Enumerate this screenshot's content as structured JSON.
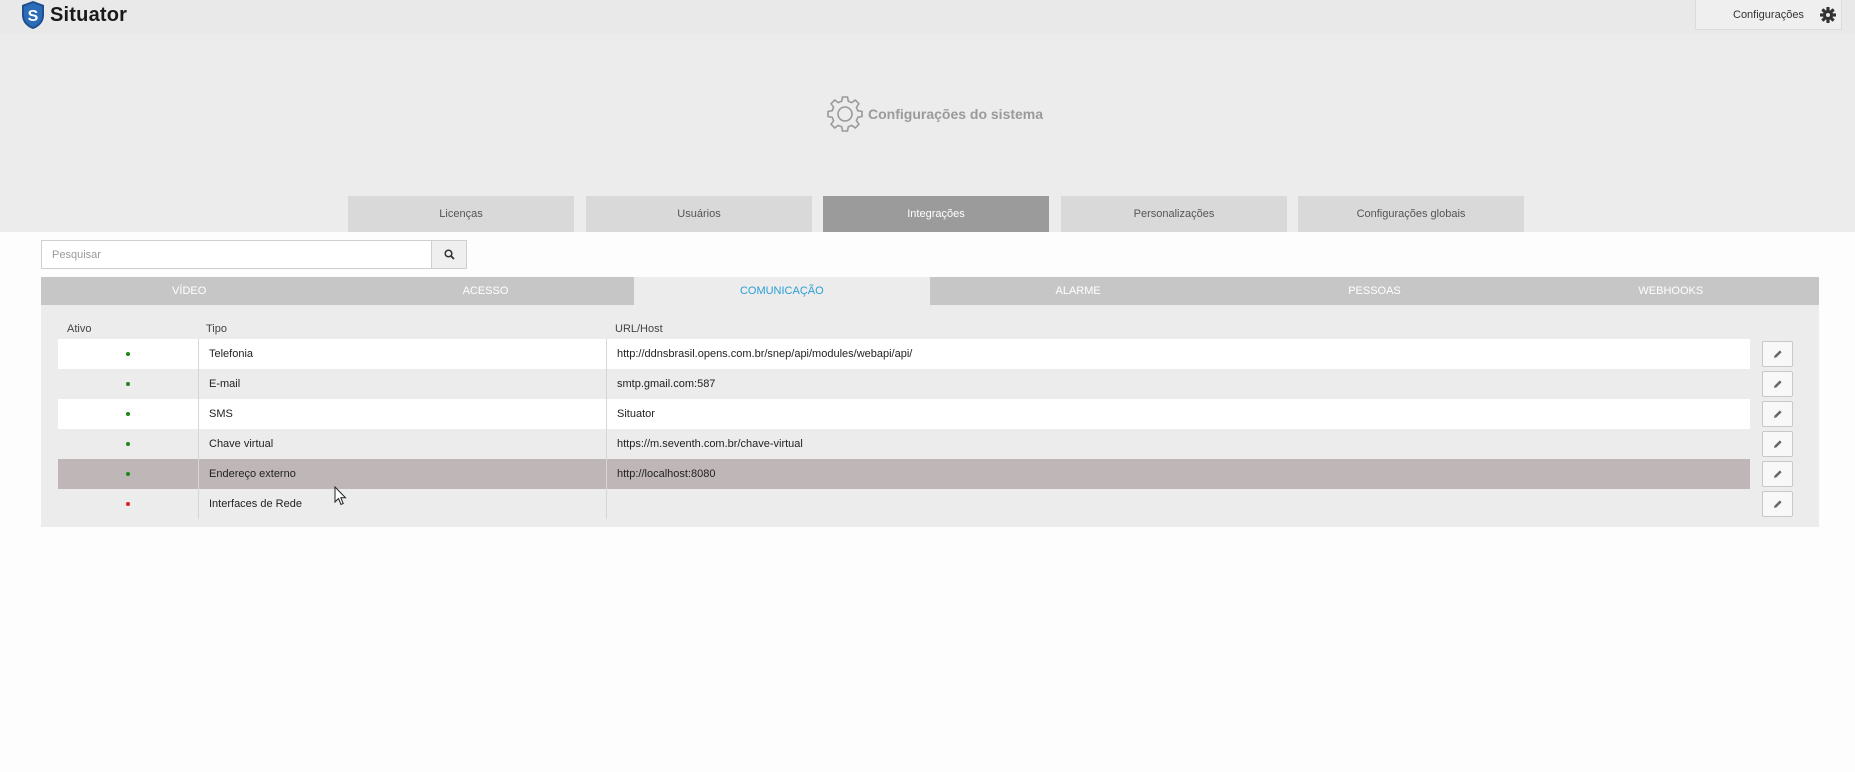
{
  "app": {
    "brand": "Situator"
  },
  "topbar": {
    "config_label": "Configurações",
    "gear_icon": "gear-icon"
  },
  "hero": {
    "title": "Configurações do sistema",
    "icon": "gear-outline-icon"
  },
  "main_tabs": [
    {
      "label": "Licenças",
      "active": false
    },
    {
      "label": "Usuários",
      "active": false
    },
    {
      "label": "Integrações",
      "active": true
    },
    {
      "label": "Personalizações",
      "active": false
    },
    {
      "label": "Configurações globais",
      "active": false
    }
  ],
  "search": {
    "placeholder": "Pesquisar",
    "value": "",
    "icon": "search-icon"
  },
  "sub_tabs": [
    {
      "label": "VÍDEO",
      "active": false
    },
    {
      "label": "ACESSO",
      "active": false
    },
    {
      "label": "COMUNICAÇÃO",
      "active": true
    },
    {
      "label": "ALARME",
      "active": false
    },
    {
      "label": "PESSOAS",
      "active": false
    },
    {
      "label": "WEBHOOKS",
      "active": false
    }
  ],
  "table": {
    "headers": {
      "ativo": "Ativo",
      "tipo": "Tipo",
      "url": "URL/Host"
    },
    "rows": [
      {
        "active": true,
        "tipo": "Telefonia",
        "url": "http://ddnsbrasil.opens.com.br/snep/api/modules/webapi/api/",
        "selected": false
      },
      {
        "active": true,
        "tipo": "E-mail",
        "url": "smtp.gmail.com:587",
        "selected": false
      },
      {
        "active": true,
        "tipo": "SMS",
        "url": "Situator",
        "selected": false
      },
      {
        "active": true,
        "tipo": "Chave virtual",
        "url": "https://m.seventh.com.br/chave-virtual",
        "selected": false
      },
      {
        "active": true,
        "tipo": "Endereço externo",
        "url": "http://localhost:8080",
        "selected": true
      },
      {
        "active": false,
        "tipo": "Interfaces de Rede",
        "url": "",
        "selected": false
      }
    ]
  },
  "colors": {
    "active_dot": "#1a8a1a",
    "inactive_dot": "#e02020",
    "accent": "#2a9fd6",
    "active_tab": "#9b9b9b"
  }
}
